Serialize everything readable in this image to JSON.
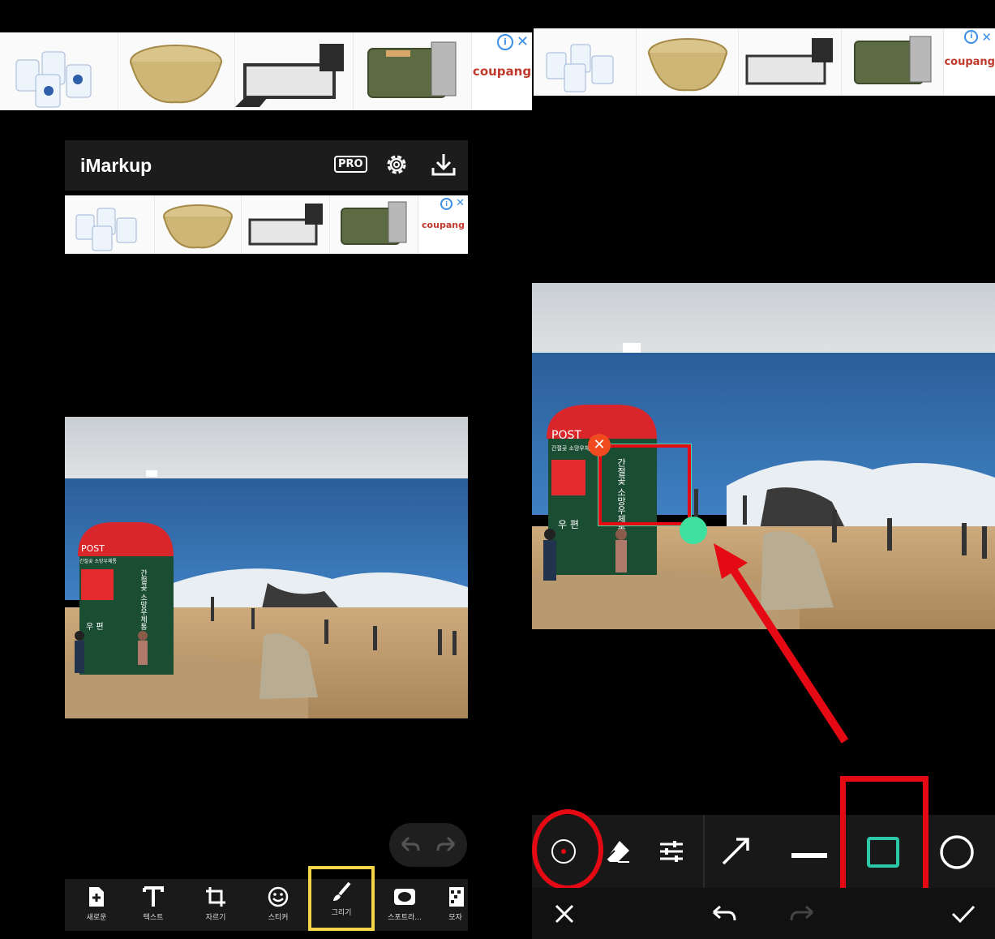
{
  "ads": {
    "brand": "coupang",
    "info_glyph": "i",
    "close_glyph": "✕"
  },
  "header": {
    "title": "iMarkup",
    "pro_label": "PRO"
  },
  "left_toolbar": {
    "items": [
      {
        "label": "새로운",
        "icon": "new-file-icon"
      },
      {
        "label": "텍스트",
        "icon": "text-icon"
      },
      {
        "label": "자르기",
        "icon": "crop-icon"
      },
      {
        "label": "스티커",
        "icon": "sticker-icon"
      },
      {
        "label": "그리기",
        "icon": "brush-icon"
      },
      {
        "label": "스포트라...",
        "icon": "spotlight-icon"
      },
      {
        "label": "모자",
        "icon": "mosaic-icon"
      }
    ],
    "active_index": 4
  },
  "photo": {
    "booth_header": "POST",
    "booth_subtitle": "간절곶 소망우체통",
    "booth_vertical": "간절곶 소망우체통",
    "booth_bottom": "우 편"
  },
  "drawing_toolbar": {
    "tools": [
      "pen-dot-icon",
      "eraser-icon",
      "sliders-icon",
      "arrow-icon",
      "line-icon",
      "rectangle-icon",
      "circle-icon"
    ],
    "active_tool": "rectangle-icon"
  },
  "colors": {
    "highlight_yellow": "#f5d547",
    "annotation_red": "#e50914",
    "teal": "#2bc8a9",
    "handle_green": "#3ee0a0"
  }
}
